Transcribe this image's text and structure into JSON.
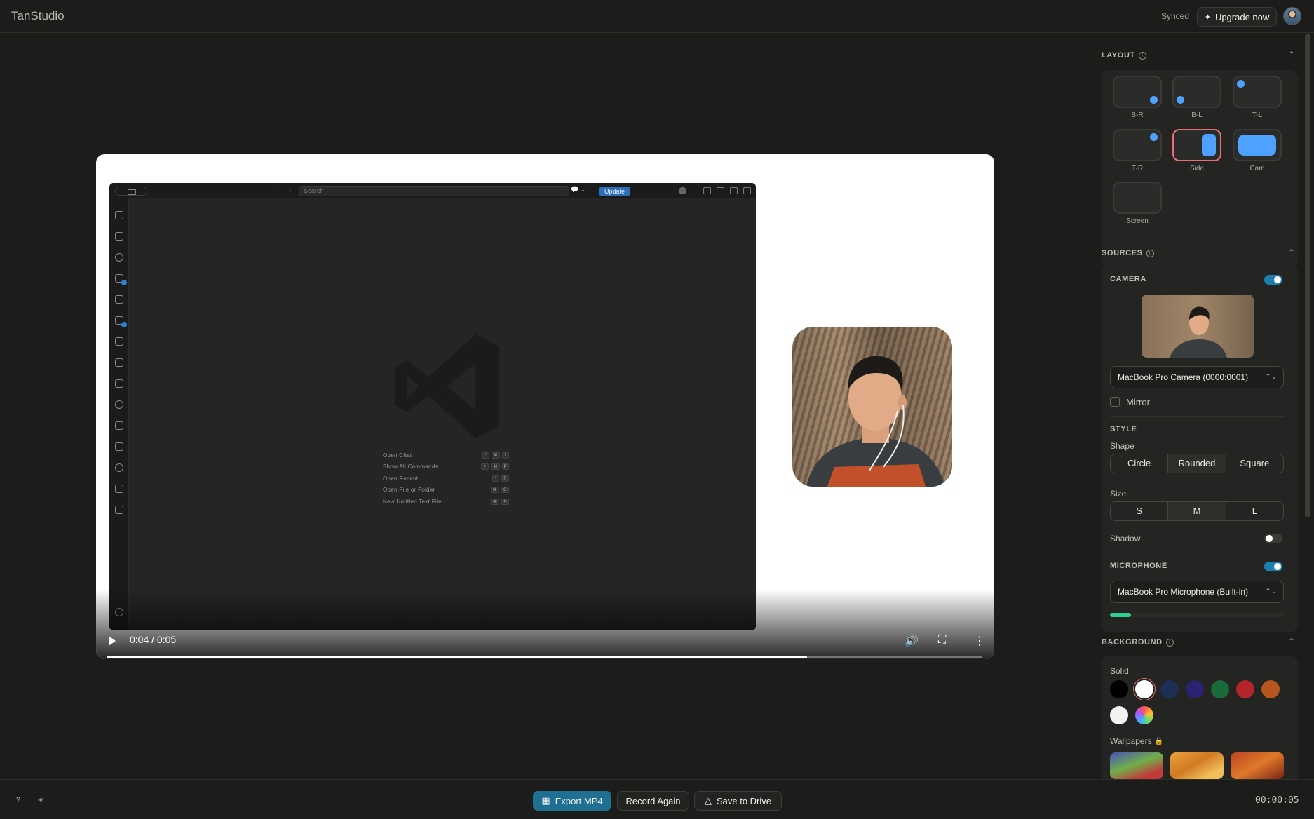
{
  "app": {
    "title": "TanStudio"
  },
  "header": {
    "sync_status": "Synced",
    "upgrade_label": "Upgrade now"
  },
  "player": {
    "time": "0:04 / 0:05",
    "progress": 0.8
  },
  "screen_recording": {
    "search_placeholder": "Search",
    "update_label": "Update",
    "shortcuts": [
      {
        "label": "Open Chat",
        "keys": [
          "^",
          "⌘",
          "I"
        ]
      },
      {
        "label": "Show All Commands",
        "keys": [
          "⇧",
          "⌘",
          "P"
        ]
      },
      {
        "label": "Open Recent",
        "keys": [
          "^",
          "R"
        ]
      },
      {
        "label": "Open File or Folder",
        "keys": [
          "⌘",
          "O"
        ]
      },
      {
        "label": "New Untitled Text File",
        "keys": [
          "⌘",
          "N"
        ]
      }
    ]
  },
  "panel": {
    "layout": {
      "title": "LAYOUT",
      "options": [
        {
          "label": "B-R"
        },
        {
          "label": "B-L"
        },
        {
          "label": "T-L"
        },
        {
          "label": "T-R"
        },
        {
          "label": "Side",
          "selected": true
        },
        {
          "label": "Cam"
        },
        {
          "label": "Screen"
        }
      ]
    },
    "sources": {
      "title": "SOURCES",
      "camera": {
        "label": "CAMERA",
        "enabled": true,
        "device": "MacBook Pro Camera (0000:0001)",
        "mirror_label": "Mirror",
        "mirror": false
      },
      "style": {
        "label": "STYLE",
        "shape_label": "Shape",
        "shapes": [
          "Circle",
          "Rounded",
          "Square"
        ],
        "shape_selected": "Rounded",
        "size_label": "Size",
        "sizes": [
          "S",
          "M",
          "L"
        ],
        "size_selected": "M",
        "shadow_label": "Shadow",
        "shadow": false
      },
      "microphone": {
        "label": "MICROPHONE",
        "enabled": true,
        "device": "MacBook Pro Microphone (Built-in)",
        "level": 0.12
      }
    },
    "background": {
      "title": "BACKGROUND",
      "solid_label": "Solid",
      "swatches": [
        "#000000",
        "#ffffff",
        "#1e2f55",
        "#2b2370",
        "#1b6b3a",
        "#b3252b",
        "#b5561c",
        "#f2f2f0",
        "gradient"
      ],
      "selected_swatch": "#ffffff",
      "wallpapers_label": "Wallpapers"
    }
  },
  "footer": {
    "export_label": "Export MP4",
    "record_again_label": "Record Again",
    "save_drive_label": "Save to Drive",
    "elapsed": "00:00:05"
  },
  "colors": {
    "accent": "#1f6f93",
    "selection": "#e86f73",
    "toggle_on": "#1d7fb1"
  }
}
